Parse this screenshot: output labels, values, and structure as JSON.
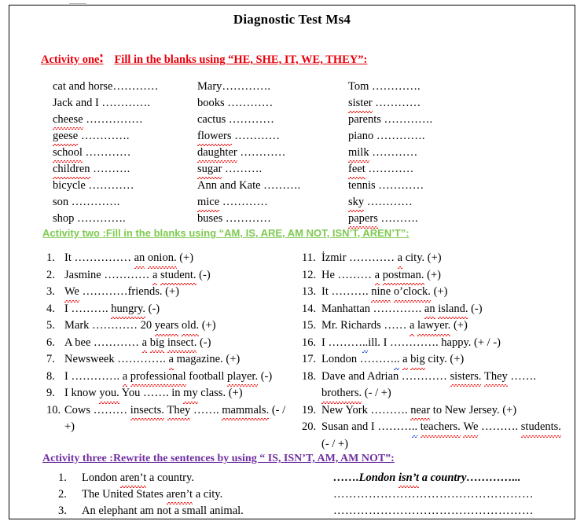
{
  "document": {
    "title": "Diagnostic Test Ms4"
  },
  "colors": {
    "activity_one": "#e8000b",
    "activity_two": "#7ec950",
    "activity_three": "#7030a0",
    "spelling_squiggle": "#f01a1a",
    "grammar_squiggle": "#2a4bd7",
    "text": "#000000",
    "border": "#000000"
  },
  "activity_one": {
    "label": "Activity one",
    "colon": "∶",
    "instruction": "Fill in the blanks using “HE, SHE, IT, WE, THEY”:",
    "columns": [
      [
        {
          "word": "cat and horse",
          "blank": "…………",
          "misspelled": false
        },
        {
          "word": "Jack and I",
          "blank": " ………….",
          "misspelled": false
        },
        {
          "word": "cheese",
          "blank": " ……………",
          "misspelled": true
        },
        {
          "word": "geese",
          "blank": " ………….",
          "misspelled": true
        },
        {
          "word": "school",
          "blank": " …………",
          "misspelled": true
        },
        {
          "word": "children",
          "blank": " ……….",
          "misspelled": true
        },
        {
          "word": "bicycle",
          "blank": " …………",
          "misspelled": false
        },
        {
          "word": "son",
          "blank": " ………….",
          "misspelled": false
        },
        {
          "word": "shop",
          "blank": " ………….",
          "misspelled": false
        }
      ],
      [
        {
          "word": "Mary",
          "blank": "………….",
          "misspelled": false
        },
        {
          "word": "books",
          "blank": " …………",
          "misspelled": false
        },
        {
          "word": "cactus",
          "blank": " …………",
          "misspelled": false
        },
        {
          "word": "flowers",
          "blank": " …………",
          "misspelled": true
        },
        {
          "word": "daughter",
          "blank": " …………",
          "misspelled": true
        },
        {
          "word": "sugar",
          "blank": " ……….",
          "misspelled": true
        },
        {
          "word": "Ann and Kate",
          "blank": " ……….",
          "misspelled": false
        },
        {
          "word": "mice",
          "blank": " …………",
          "misspelled": true
        },
        {
          "word": "buses",
          "blank": " …………",
          "misspelled": false
        }
      ],
      [
        {
          "word": "Tom",
          "blank": " ………….",
          "misspelled": false
        },
        {
          "word": "sister",
          "blank": " …………",
          "misspelled": true
        },
        {
          "word": "parents",
          "blank": " ………….",
          "misspelled": false
        },
        {
          "word": "piano",
          "blank": " ………….",
          "misspelled": false
        },
        {
          "word": "milk",
          "blank": " …………",
          "misspelled": true
        },
        {
          "word": "feet",
          "blank": " …………",
          "misspelled": true
        },
        {
          "word": "tennis",
          "blank": " …………",
          "misspelled": false
        },
        {
          "word": "sky",
          "blank": " …………",
          "misspelled": true
        },
        {
          "word": "papers",
          "blank": " ……….",
          "misspelled": true
        }
      ]
    ]
  },
  "activity_two": {
    "label": "Activity two :",
    "instruction": "Fill in the blanks using “AM, IS, ARE, AM NOT, ISN’T, AREN’T”:",
    "left_items": [
      {
        "n": "1.",
        "text": "It …………… an onion. (+)"
      },
      {
        "n": "2.",
        "text": "Jasmine ………… a student. (-)"
      },
      {
        "n": "3.",
        "text": "We …………friends. (+)"
      },
      {
        "n": "4.",
        "text": "I ………. hungry. (-)"
      },
      {
        "n": "5.",
        "text": "Mark ………… 20 years old. (+)"
      },
      {
        "n": "6.",
        "text": "A bee ………… a big insect. (-)"
      },
      {
        "n": "7.",
        "text": "Newsweek …………. a magazine. (+)"
      },
      {
        "n": "8.",
        "text": "I …………. a professional football player. (-)"
      },
      {
        "n": "9.",
        "text": "I know you. You ……. in my class. (+)"
      },
      {
        "n": "10.",
        "text": "Cows ……… insects. They ……. mammals. (- / +)"
      }
    ],
    "right_items": [
      {
        "n": "11.",
        "text": "İzmir ………… a city. (+)"
      },
      {
        "n": "12.",
        "text": "He ……… a postman. (+)"
      },
      {
        "n": "13.",
        "text": "It ………. nine o’clock. (+)"
      },
      {
        "n": "14.",
        "text": "Manhattan …………. an island. (-)"
      },
      {
        "n": "15.",
        "text": "Mr. Richards …… a lawyer. (+)"
      },
      {
        "n": "16.",
        "text": "I ………..ill. I …………. happy. (+ / -)"
      },
      {
        "n": "17.",
        "text": "London ……….. a big city. (+)"
      },
      {
        "n": "18.",
        "text": "Dave and Adrian ………… sisters. They ……. brothers. (- / +)"
      },
      {
        "n": "19.",
        "text": "New York ………. near to New Jersey. (+)"
      },
      {
        "n": "20.",
        "text": "Susan and I ……….. teachers. We ………. students. (- / +)"
      }
    ]
  },
  "activity_three": {
    "label": "Activity three :",
    "instruction": "Rewrite the sentences by using “ IS, ISN’T, AM, AM NOT”:",
    "items": [
      {
        "n": "1.",
        "sentence": "London aren’t a country.",
        "answer": "…….London isn’t a country…………...",
        "answer_is_example": true
      },
      {
        "n": "2.",
        "sentence": "The United States aren’t a city.",
        "answer": "……………………………………………",
        "answer_is_example": false
      },
      {
        "n": "3.",
        "sentence": "An elephant am not a small animal.",
        "answer": "……………………………………………",
        "answer_is_example": false
      }
    ]
  }
}
